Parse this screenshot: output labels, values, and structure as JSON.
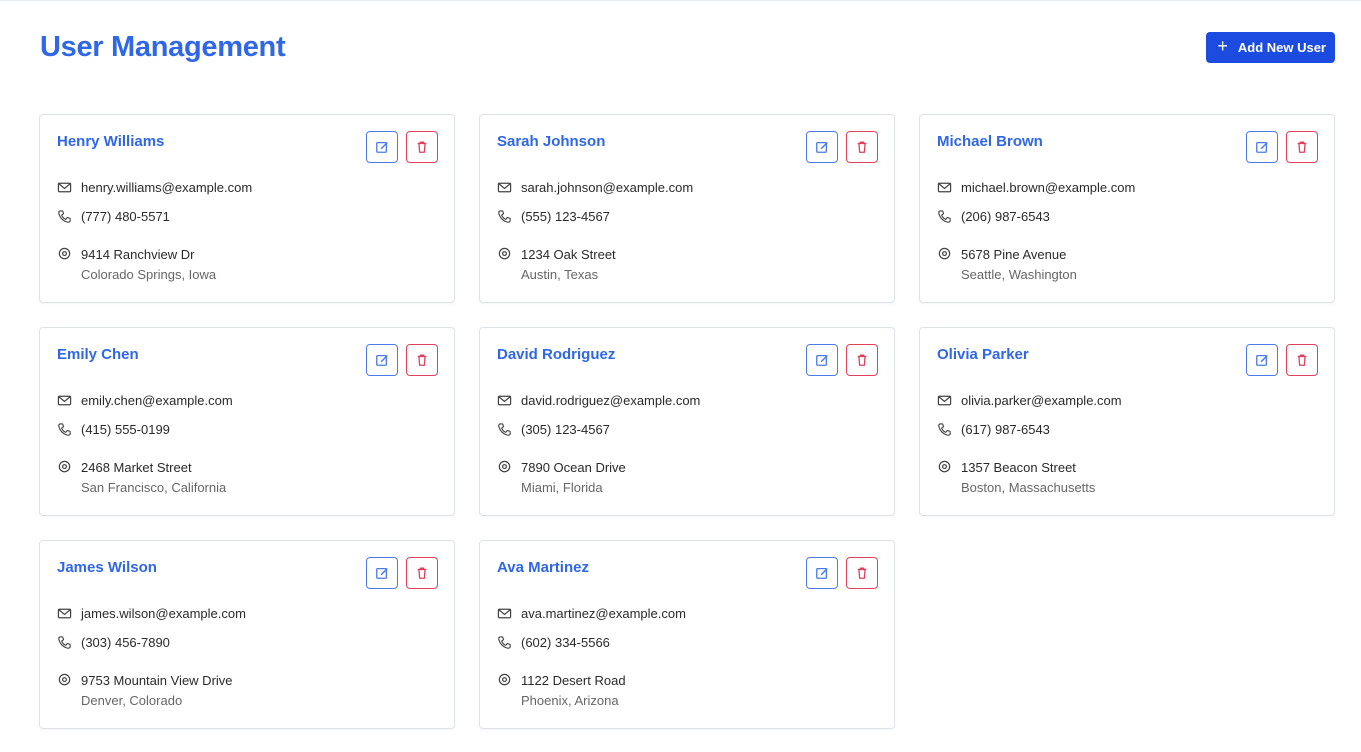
{
  "page": {
    "title": "User Management",
    "add_button_label": "Add New User",
    "accent_color": "#2f67e7",
    "delete_color": "#e0405a"
  },
  "users": [
    {
      "name": "Henry Williams",
      "email": "henry.williams@example.com",
      "phone": "(777) 480-5571",
      "street": "9414 Ranchview Dr",
      "city": "Colorado Springs, Iowa"
    },
    {
      "name": "Sarah Johnson",
      "email": "sarah.johnson@example.com",
      "phone": "(555) 123-4567",
      "street": "1234 Oak Street",
      "city": "Austin, Texas"
    },
    {
      "name": "Michael Brown",
      "email": "michael.brown@example.com",
      "phone": "(206) 987-6543",
      "street": "5678 Pine Avenue",
      "city": "Seattle, Washington"
    },
    {
      "name": "Emily Chen",
      "email": "emily.chen@example.com",
      "phone": "(415) 555-0199",
      "street": "2468 Market Street",
      "city": "San Francisco, California"
    },
    {
      "name": "David Rodriguez",
      "email": "david.rodriguez@example.com",
      "phone": "(305) 123-4567",
      "street": "7890 Ocean Drive",
      "city": "Miami, Florida"
    },
    {
      "name": "Olivia Parker",
      "email": "olivia.parker@example.com",
      "phone": "(617) 987-6543",
      "street": "1357 Beacon Street",
      "city": "Boston, Massachusetts"
    },
    {
      "name": "James Wilson",
      "email": "james.wilson@example.com",
      "phone": "(303) 456-7890",
      "street": "9753 Mountain View Drive",
      "city": "Denver, Colorado"
    },
    {
      "name": "Ava Martinez",
      "email": "ava.martinez@example.com",
      "phone": "(602) 334-5566",
      "street": "1122 Desert Road",
      "city": "Phoenix, Arizona"
    }
  ],
  "icons": {
    "add": "plus-icon",
    "edit": "edit-icon",
    "delete": "trash-icon",
    "email": "mail-icon",
    "phone": "phone-icon",
    "address": "map-pin-icon"
  }
}
